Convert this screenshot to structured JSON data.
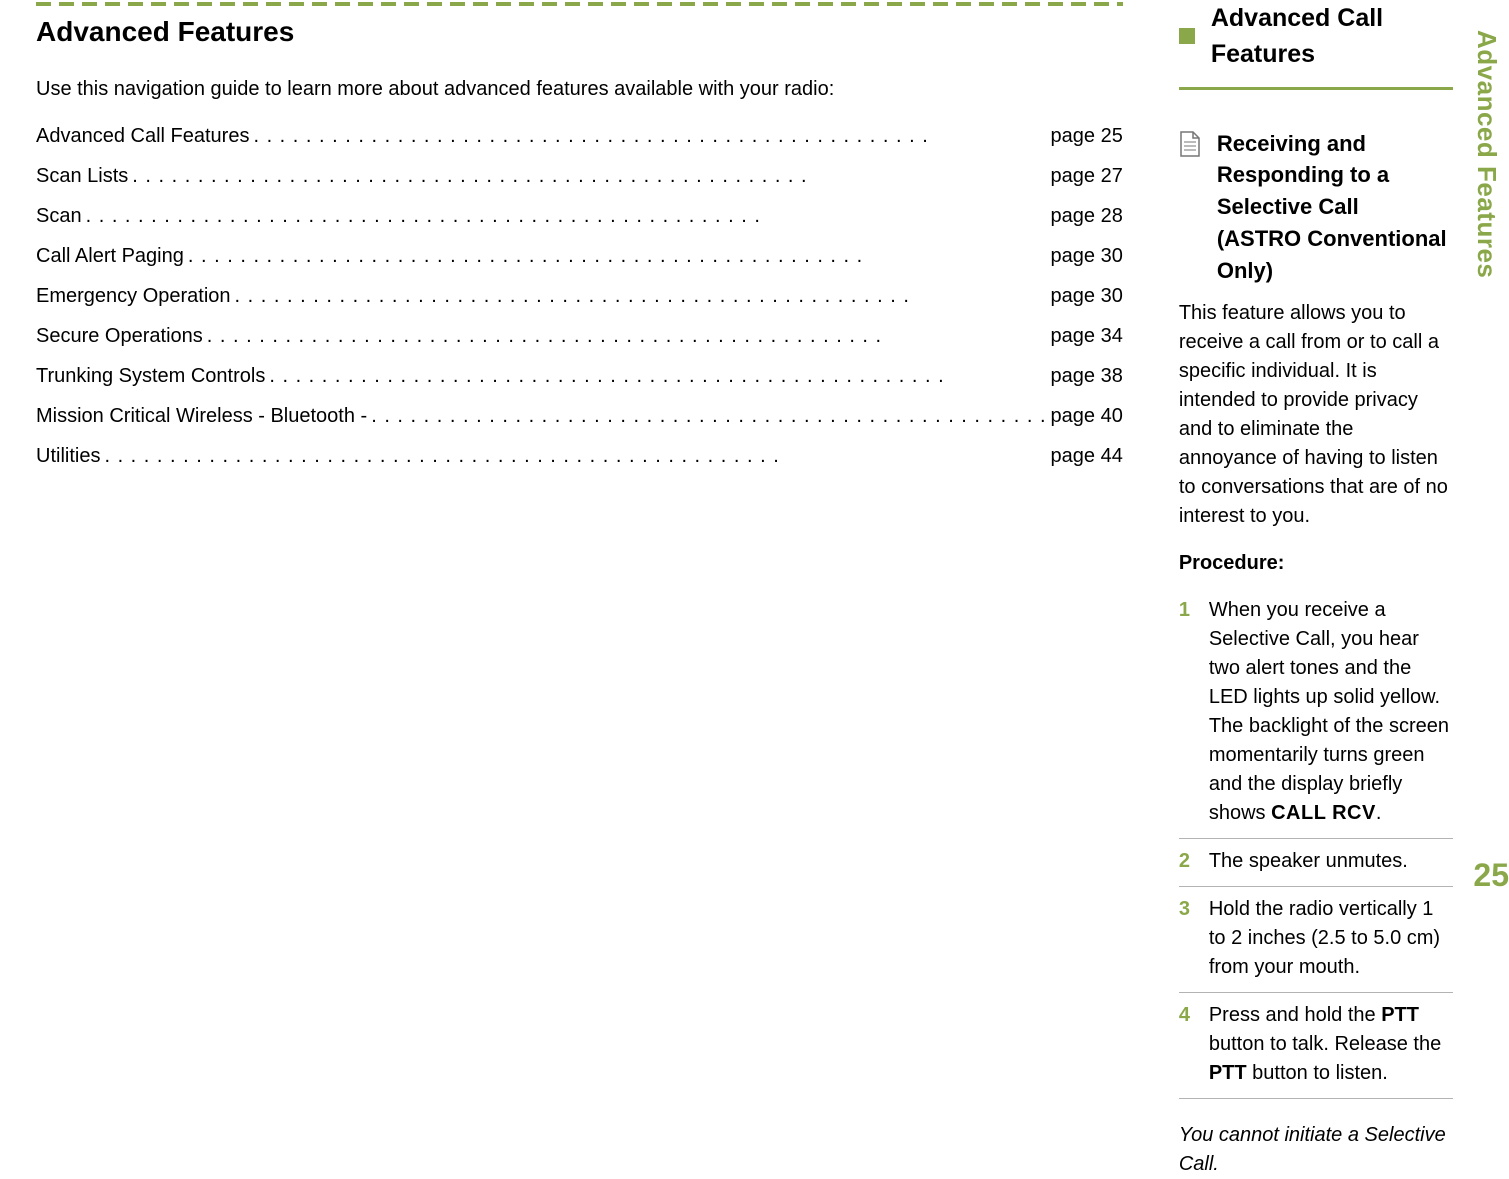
{
  "sideTab": "Advanced Features",
  "pageNumber": "25",
  "left": {
    "heading": "Advanced Features",
    "intro": "Use this navigation guide to learn more about advanced features available with your radio:",
    "toc": [
      {
        "label": "Advanced Call Features",
        "page": "page 25"
      },
      {
        "label": "Scan Lists",
        "page": "page 27"
      },
      {
        "label": "Scan",
        "page": "page 28"
      },
      {
        "label": "Call Alert Paging",
        "page": "page 30"
      },
      {
        "label": "Emergency Operation",
        "page": "page 30"
      },
      {
        "label": "Secure Operations",
        "page": "page 34"
      },
      {
        "label": "Trunking System Controls",
        "page": "page 38"
      },
      {
        "label": "Mission Critical Wireless - Bluetooth -",
        "page": "page 40"
      },
      {
        "label": "Utilities",
        "page": "page 44"
      }
    ]
  },
  "right": {
    "sectionTitle": "Advanced Call Features",
    "topicTitleLine1": "Receiving and Responding to a Selective Call",
    "topicTitleLine2": "(ASTRO Conventional Only)",
    "topicIconName": "document-icon",
    "para": "This feature allows you to receive a call from or to call a specific individual. It is intended to provide privacy and to eliminate the annoyance of having to listen to conversations that are of no interest to you.",
    "procLabel": "Procedure:",
    "steps": {
      "s1a": "When you receive a Selective Call, you hear two alert tones and the LED lights up solid yellow. The backlight of the screen momentarily turns green and the display briefly shows ",
      "s1code": "CALL RCV",
      "s1b": ".",
      "s2": "The speaker unmutes.",
      "s3": "Hold the radio vertically 1 to 2 inches (2.5 to 5.0 cm) from your mouth.",
      "s4a": "Press and hold the ",
      "s4b": "PTT",
      "s4c": " button to talk. Release the ",
      "s4d": "PTT",
      "s4e": " button to listen."
    },
    "stepNums": {
      "n1": "1",
      "n2": "2",
      "n3": "3",
      "n4": "4"
    },
    "note": "You cannot initiate a Selective Call."
  }
}
